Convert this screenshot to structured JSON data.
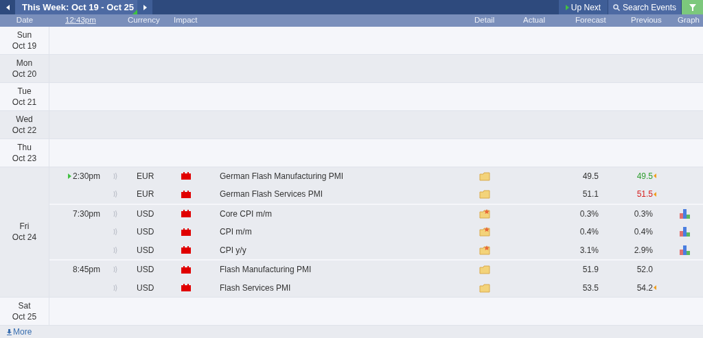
{
  "toolbar": {
    "title": "This Week: Oct 19 - Oct 25",
    "up_next": "Up Next",
    "search": "Search Events"
  },
  "columns": {
    "date": "Date",
    "time": "12:43pm",
    "currency": "Currency",
    "impact": "Impact",
    "detail": "Detail",
    "actual": "Actual",
    "forecast": "Forecast",
    "previous": "Previous",
    "graph": "Graph"
  },
  "days": [
    {
      "day": "Sun",
      "date": "Oct 19"
    },
    {
      "day": "Mon",
      "date": "Oct 20"
    },
    {
      "day": "Tue",
      "date": "Oct 21"
    },
    {
      "day": "Wed",
      "date": "Oct 22"
    },
    {
      "day": "Thu",
      "date": "Oct 23"
    },
    {
      "day": "Fri",
      "date": "Oct 24",
      "groups": [
        {
          "time": "2:30pm",
          "next": true,
          "events": [
            {
              "currency": "EUR",
              "name": "German Flash Manufacturing PMI",
              "kind": "plain",
              "forecast": "49.5",
              "previous": {
                "text": "49.5",
                "color": "#2f9e2f"
              },
              "revised": true,
              "graph": false
            },
            {
              "currency": "EUR",
              "name": "German Flash Services PMI",
              "kind": "plain",
              "forecast": "51.1",
              "previous": {
                "text": "51.5",
                "color": "#d62020"
              },
              "revised": true,
              "graph": false
            }
          ]
        },
        {
          "time": "7:30pm",
          "next": false,
          "events": [
            {
              "currency": "USD",
              "name": "Core CPI m/m",
              "kind": "starred",
              "forecast": "0.3%",
              "previous": {
                "text": "0.3%",
                "color": "#333333"
              },
              "revised": false,
              "graph": true
            },
            {
              "currency": "USD",
              "name": "CPI m/m",
              "kind": "starred",
              "forecast": "0.4%",
              "previous": {
                "text": "0.4%",
                "color": "#333333"
              },
              "revised": false,
              "graph": true
            },
            {
              "currency": "USD",
              "name": "CPI y/y",
              "kind": "starred",
              "forecast": "3.1%",
              "previous": {
                "text": "2.9%",
                "color": "#333333"
              },
              "revised": false,
              "graph": true
            }
          ]
        },
        {
          "time": "8:45pm",
          "next": false,
          "events": [
            {
              "currency": "USD",
              "name": "Flash Manufacturing PMI",
              "kind": "plain",
              "forecast": "51.9",
              "previous": {
                "text": "52.0",
                "color": "#333333"
              },
              "revised": false,
              "graph": false
            },
            {
              "currency": "USD",
              "name": "Flash Services PMI",
              "kind": "plain",
              "forecast": "53.5",
              "previous": {
                "text": "54.2",
                "color": "#333333"
              },
              "revised": true,
              "graph": false
            }
          ]
        }
      ]
    },
    {
      "day": "Sat",
      "date": "Oct 25"
    }
  ],
  "more": "More"
}
